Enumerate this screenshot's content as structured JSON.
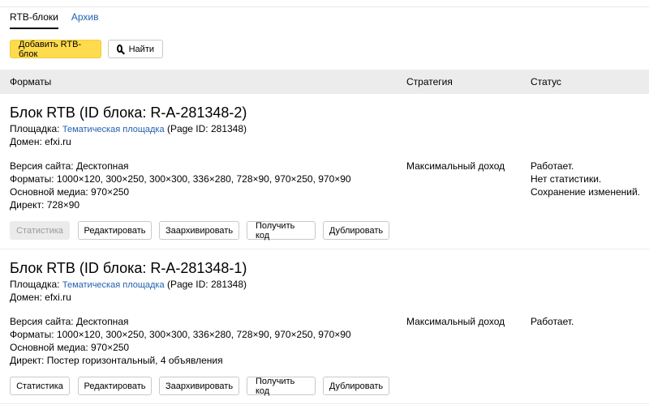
{
  "tabs": [
    {
      "label": "RTB-блоки"
    },
    {
      "label": "Архив"
    }
  ],
  "toolbar": {
    "add_label": "Добавить RTB-блок",
    "find_label": "Найти"
  },
  "table_header": {
    "formats": "Форматы",
    "strategy": "Стратегия",
    "status": "Статус"
  },
  "blocks": [
    {
      "title": "Блок RTB (ID блока: R-A-281348-2)",
      "platform_label": "Площадка:",
      "platform_link": "Тематическая площадка",
      "page_id": "(Page ID: 281348)",
      "domain": "Домен: efxi.ru",
      "site_version": "Версия сайта:  Десктопная",
      "formats": "Форматы:  1000×120, 300×250, 300×300, 336×280, 728×90, 970×250, 970×90",
      "main_media": "Основной медиа:  970×250",
      "direct": "Директ:  728×90",
      "strategy": "Максимальный доход",
      "status": [
        "Работает.",
        "Нет статистики.",
        "Сохранение изменений."
      ],
      "buttons": [
        "Статистика",
        "Редактировать",
        "Заархивировать",
        "Получить код",
        "Дублировать"
      ]
    },
    {
      "title": "Блок RTB (ID блока: R-A-281348-1)",
      "platform_label": "Площадка:",
      "platform_link": "Тематическая площадка",
      "page_id": "(Page ID: 281348)",
      "domain": "Домен: efxi.ru",
      "site_version": "Версия сайта:  Десктопная",
      "formats": "Форматы:  1000×120, 300×250, 300×300, 336×280, 728×90, 970×250, 970×90",
      "main_media": "Основной медиа:  970×250",
      "direct": "Директ:  Постер горизонтальный, 4 объявления",
      "strategy": "Максимальный доход",
      "status": [
        "Работает."
      ],
      "buttons": [
        "Статистика",
        "Редактировать",
        "Заархивировать",
        "Получить код",
        "Дублировать"
      ]
    }
  ]
}
